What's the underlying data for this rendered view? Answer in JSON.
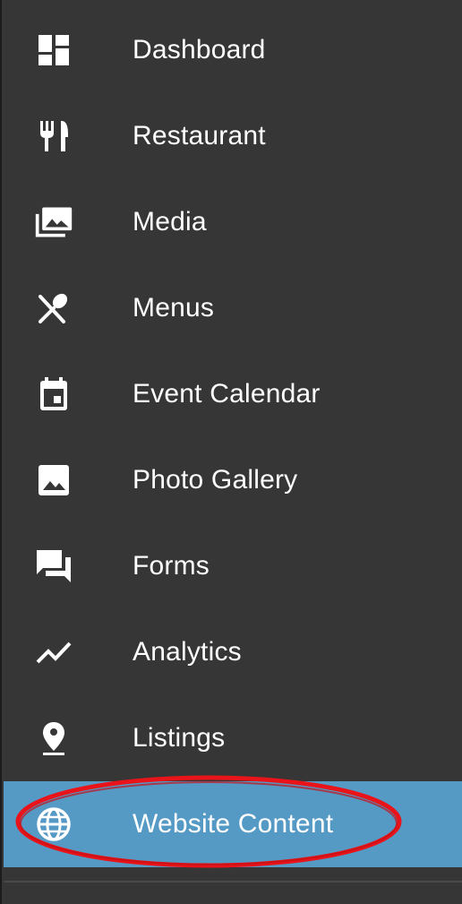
{
  "sidebar": {
    "items": [
      {
        "label": "Dashboard",
        "icon": "dashboard-icon"
      },
      {
        "label": "Restaurant",
        "icon": "fork-knife-icon"
      },
      {
        "label": "Media",
        "icon": "photo-library-icon"
      },
      {
        "label": "Menus",
        "icon": "fork-spoon-crossed-icon"
      },
      {
        "label": "Event Calendar",
        "icon": "calendar-event-icon"
      },
      {
        "label": "Photo Gallery",
        "icon": "image-icon"
      },
      {
        "label": "Forms",
        "icon": "forum-icon"
      },
      {
        "label": "Analytics",
        "icon": "trending-up-icon"
      },
      {
        "label": "Listings",
        "icon": "location-pin-icon"
      },
      {
        "label": "Website Content",
        "icon": "globe-icon",
        "selected": true
      }
    ]
  },
  "colors": {
    "background": "#363636",
    "selected": "#5599c5",
    "highlight_ring": "#e8141a",
    "text": "#ffffff"
  }
}
